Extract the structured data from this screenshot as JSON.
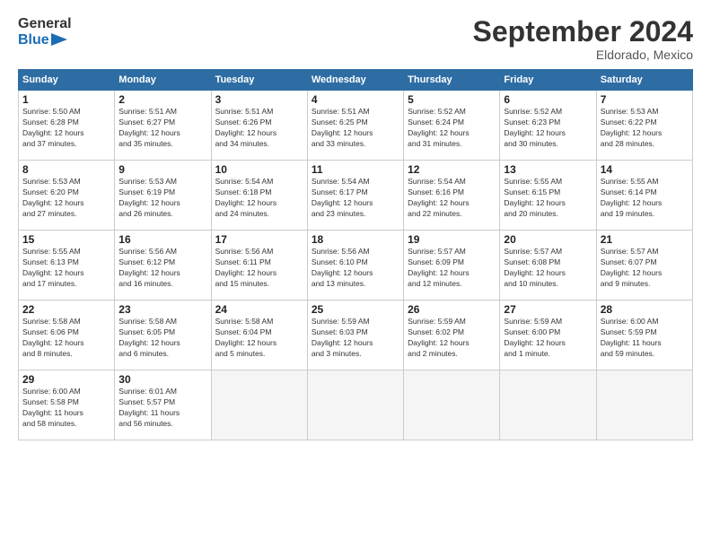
{
  "logo": {
    "text_general": "General",
    "text_blue": "Blue"
  },
  "title": "September 2024",
  "subtitle": "Eldorado, Mexico",
  "columns": [
    "Sunday",
    "Monday",
    "Tuesday",
    "Wednesday",
    "Thursday",
    "Friday",
    "Saturday"
  ],
  "weeks": [
    [
      {
        "day": "1",
        "info": "Sunrise: 5:50 AM\nSunset: 6:28 PM\nDaylight: 12 hours\nand 37 minutes."
      },
      {
        "day": "2",
        "info": "Sunrise: 5:51 AM\nSunset: 6:27 PM\nDaylight: 12 hours\nand 35 minutes."
      },
      {
        "day": "3",
        "info": "Sunrise: 5:51 AM\nSunset: 6:26 PM\nDaylight: 12 hours\nand 34 minutes."
      },
      {
        "day": "4",
        "info": "Sunrise: 5:51 AM\nSunset: 6:25 PM\nDaylight: 12 hours\nand 33 minutes."
      },
      {
        "day": "5",
        "info": "Sunrise: 5:52 AM\nSunset: 6:24 PM\nDaylight: 12 hours\nand 31 minutes."
      },
      {
        "day": "6",
        "info": "Sunrise: 5:52 AM\nSunset: 6:23 PM\nDaylight: 12 hours\nand 30 minutes."
      },
      {
        "day": "7",
        "info": "Sunrise: 5:53 AM\nSunset: 6:22 PM\nDaylight: 12 hours\nand 28 minutes."
      }
    ],
    [
      {
        "day": "8",
        "info": "Sunrise: 5:53 AM\nSunset: 6:20 PM\nDaylight: 12 hours\nand 27 minutes."
      },
      {
        "day": "9",
        "info": "Sunrise: 5:53 AM\nSunset: 6:19 PM\nDaylight: 12 hours\nand 26 minutes."
      },
      {
        "day": "10",
        "info": "Sunrise: 5:54 AM\nSunset: 6:18 PM\nDaylight: 12 hours\nand 24 minutes."
      },
      {
        "day": "11",
        "info": "Sunrise: 5:54 AM\nSunset: 6:17 PM\nDaylight: 12 hours\nand 23 minutes."
      },
      {
        "day": "12",
        "info": "Sunrise: 5:54 AM\nSunset: 6:16 PM\nDaylight: 12 hours\nand 22 minutes."
      },
      {
        "day": "13",
        "info": "Sunrise: 5:55 AM\nSunset: 6:15 PM\nDaylight: 12 hours\nand 20 minutes."
      },
      {
        "day": "14",
        "info": "Sunrise: 5:55 AM\nSunset: 6:14 PM\nDaylight: 12 hours\nand 19 minutes."
      }
    ],
    [
      {
        "day": "15",
        "info": "Sunrise: 5:55 AM\nSunset: 6:13 PM\nDaylight: 12 hours\nand 17 minutes."
      },
      {
        "day": "16",
        "info": "Sunrise: 5:56 AM\nSunset: 6:12 PM\nDaylight: 12 hours\nand 16 minutes."
      },
      {
        "day": "17",
        "info": "Sunrise: 5:56 AM\nSunset: 6:11 PM\nDaylight: 12 hours\nand 15 minutes."
      },
      {
        "day": "18",
        "info": "Sunrise: 5:56 AM\nSunset: 6:10 PM\nDaylight: 12 hours\nand 13 minutes."
      },
      {
        "day": "19",
        "info": "Sunrise: 5:57 AM\nSunset: 6:09 PM\nDaylight: 12 hours\nand 12 minutes."
      },
      {
        "day": "20",
        "info": "Sunrise: 5:57 AM\nSunset: 6:08 PM\nDaylight: 12 hours\nand 10 minutes."
      },
      {
        "day": "21",
        "info": "Sunrise: 5:57 AM\nSunset: 6:07 PM\nDaylight: 12 hours\nand 9 minutes."
      }
    ],
    [
      {
        "day": "22",
        "info": "Sunrise: 5:58 AM\nSunset: 6:06 PM\nDaylight: 12 hours\nand 8 minutes."
      },
      {
        "day": "23",
        "info": "Sunrise: 5:58 AM\nSunset: 6:05 PM\nDaylight: 12 hours\nand 6 minutes."
      },
      {
        "day": "24",
        "info": "Sunrise: 5:58 AM\nSunset: 6:04 PM\nDaylight: 12 hours\nand 5 minutes."
      },
      {
        "day": "25",
        "info": "Sunrise: 5:59 AM\nSunset: 6:03 PM\nDaylight: 12 hours\nand 3 minutes."
      },
      {
        "day": "26",
        "info": "Sunrise: 5:59 AM\nSunset: 6:02 PM\nDaylight: 12 hours\nand 2 minutes."
      },
      {
        "day": "27",
        "info": "Sunrise: 5:59 AM\nSunset: 6:00 PM\nDaylight: 12 hours\nand 1 minute."
      },
      {
        "day": "28",
        "info": "Sunrise: 6:00 AM\nSunset: 5:59 PM\nDaylight: 11 hours\nand 59 minutes."
      }
    ],
    [
      {
        "day": "29",
        "info": "Sunrise: 6:00 AM\nSunset: 5:58 PM\nDaylight: 11 hours\nand 58 minutes."
      },
      {
        "day": "30",
        "info": "Sunrise: 6:01 AM\nSunset: 5:57 PM\nDaylight: 11 hours\nand 56 minutes."
      },
      {
        "day": "",
        "info": ""
      },
      {
        "day": "",
        "info": ""
      },
      {
        "day": "",
        "info": ""
      },
      {
        "day": "",
        "info": ""
      },
      {
        "day": "",
        "info": ""
      }
    ]
  ]
}
